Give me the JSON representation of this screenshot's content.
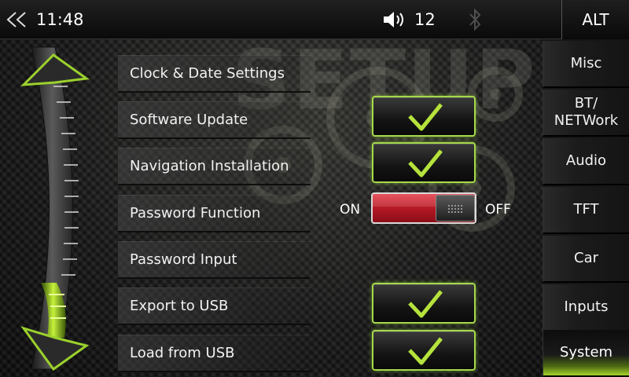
{
  "status_bar": {
    "time": "11:48",
    "volume": "12",
    "alt_label": "ALT",
    "icons": [
      "back-chevrons-icon",
      "speaker-icon",
      "bluetooth-icon"
    ]
  },
  "watermark": "SETUP",
  "menu": {
    "items": [
      {
        "label": "Clock & Date Settings"
      },
      {
        "label": "Software Update"
      },
      {
        "label": "Navigation Installation"
      },
      {
        "label": "Password Function"
      },
      {
        "label": "Password Input"
      },
      {
        "label": "Export to USB"
      },
      {
        "label": "Load from USB"
      }
    ]
  },
  "password_toggle": {
    "on_label": "ON",
    "off_label": "OFF",
    "state": "OFF"
  },
  "tabs": [
    {
      "label": "Misc",
      "active": false
    },
    {
      "label": "BT/\nNETWork",
      "active": false
    },
    {
      "label": "Audio",
      "active": false
    },
    {
      "label": "TFT",
      "active": false
    },
    {
      "label": "Car",
      "active": false
    },
    {
      "label": "Inputs",
      "active": false
    },
    {
      "label": "System",
      "active": true
    }
  ],
  "colors": {
    "accent_green": "#a6d94a",
    "toggle_red": "#c4202b",
    "background": "#1a1a1a"
  }
}
